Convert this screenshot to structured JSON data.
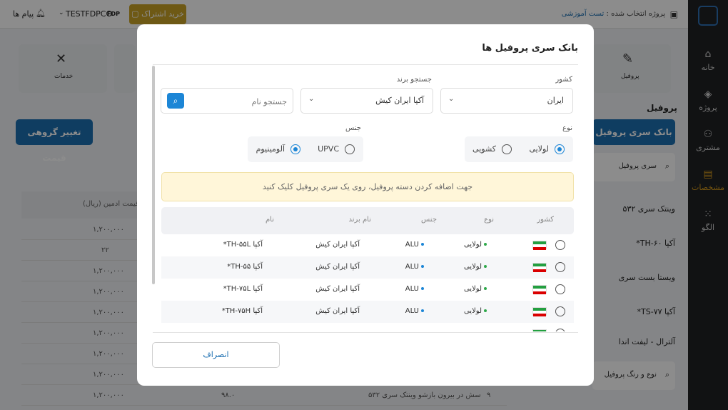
{
  "sidebar": {
    "items": [
      {
        "label": "خانه",
        "icon": "home-icon",
        "glyph": "⌂"
      },
      {
        "label": "پروژه",
        "icon": "layers-icon",
        "glyph": "◈"
      },
      {
        "label": "مشتری",
        "icon": "users-icon",
        "glyph": "⚇"
      },
      {
        "label": "مشخصات",
        "icon": "clipboard-icon",
        "glyph": "▤"
      },
      {
        "label": "الگو",
        "icon": "grid-icon",
        "glyph": "⁙"
      }
    ]
  },
  "topbar": {
    "project_prefix": "پروژه انتخاب شده :",
    "project_name": "تست آموزشی",
    "subscribe": "خرید اشتراک",
    "user": "TESTFDPCO",
    "badge": "FDP",
    "messages": "پیام ها"
  },
  "background": {
    "card_profile": "پروفیل",
    "card_services": "خدمات",
    "section_title": "پروفیل",
    "bank_button": "بانک سری پروفیل ها",
    "group_price_button": "تغییر گروهی قیمت",
    "search_series": "سری پروفیل",
    "series_list": [
      "وینتک سری ۵۳۲",
      "آکپا TH-۶۰*",
      "ویستا بست سری",
      "آکپا TS-۷۷*",
      "آلترال - لیفت اندا"
    ],
    "search_type_color": "نوع و رنگ پروفیل",
    "price_header": "قیمت ادمین (ریال)",
    "prices": [
      "۱,۲۰۰,۰۰۰",
      "۲۲",
      "۱,۲۰۰,۰۰۰",
      "۱,۲۰۰,۰۰۰",
      "۱,۲۰۰,۰۰۰",
      "۱,۲۰۰,۰۰۰",
      "۱,۲۰۰,۰۰۰",
      "۱,۲۰۰,۰۰۰",
      "۱,۲۰۰,۰۰۰"
    ],
    "last_row_num": "۹",
    "last_row_name": "سش در بیرون بازشو وینتک سری ۵۳۲",
    "last_row_value": "۹۸.۰"
  },
  "modal": {
    "title": "بانک سری پروفیل ها",
    "country_label": "کشور",
    "country_value": "ایران",
    "brand_label": "جستجو برند",
    "brand_value": "آکپا ایران کیش",
    "name_placeholder": "جستجو نام",
    "type_label": "نوع",
    "type_options": [
      "لولایی",
      "کشویی"
    ],
    "material_label": "جنس",
    "material_options": [
      "UPVC",
      "آلومینیوم"
    ],
    "alert": "جهت اضافه کردن دسته پروفیل، روی یک سری پروفیل کلیک کنید",
    "columns": [
      "کشور",
      "نوع",
      "جنس",
      "نام برند",
      "نام"
    ],
    "rows": [
      {
        "type": "لولایی",
        "material": "ALU",
        "brand": "آکپا ایران کیش",
        "name": "آکپا TH-۵۵L*"
      },
      {
        "type": "لولایی",
        "material": "ALU",
        "brand": "آکپا ایران کیش",
        "name": "آکپا TH-۵۵*"
      },
      {
        "type": "لولایی",
        "material": "ALU",
        "brand": "آکپا ایران کیش",
        "name": "آکپا TH-۷۵L*"
      },
      {
        "type": "لولایی",
        "material": "ALU",
        "brand": "آکپا ایران کیش",
        "name": "آکپا TH-۷۵H*"
      }
    ],
    "cancel": "انصراف"
  },
  "colors": {
    "accent": "#1c86d6",
    "primary": "#1c6fb1",
    "gold": "#c9a227",
    "sidebar": "#1f2124",
    "active_nav": "#d59a1c"
  }
}
